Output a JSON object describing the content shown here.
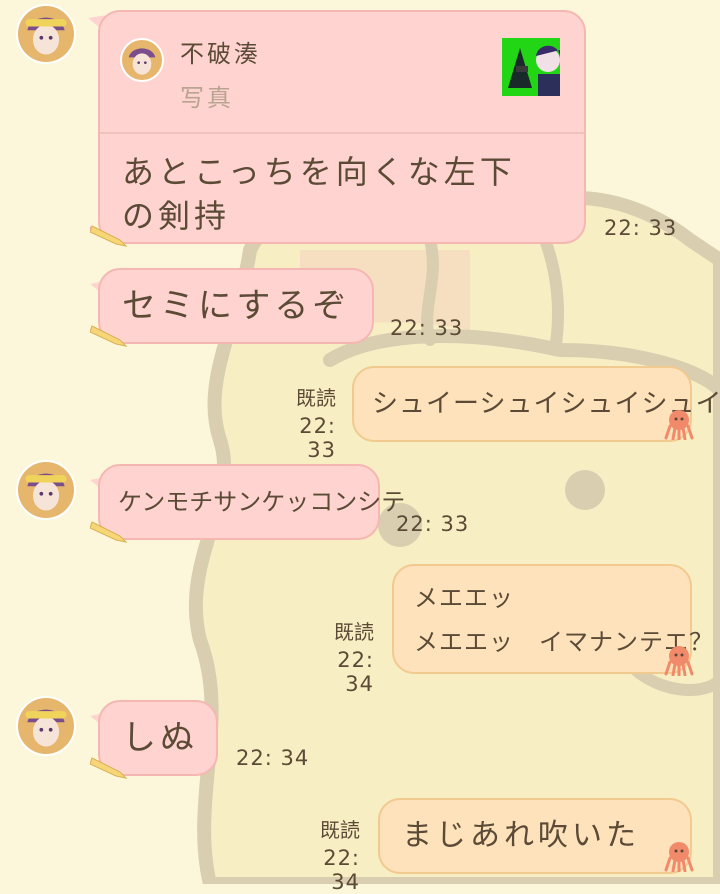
{
  "chat": {
    "messages": [
      {
        "side": "in",
        "reply": {
          "sender": "不破湊",
          "type": "写真"
        },
        "text": "あとこっちを向くな左下\nの剣持",
        "time": "22: 33"
      },
      {
        "side": "in",
        "text": "セミにするぞ",
        "time": "22: 33"
      },
      {
        "side": "out",
        "text": "シュイーシュイシュイシュイ…",
        "read": "既読",
        "time": "22: 33"
      },
      {
        "side": "in",
        "text": "ケンモチサンケッコンシテ",
        "time": "22: 33"
      },
      {
        "side": "out",
        "text": "メエエッ\nメエエッ　イマナンテエ？",
        "read": "既読",
        "time": "22: 34"
      },
      {
        "side": "in",
        "text": "しぬ",
        "time": "22: 34"
      },
      {
        "side": "out",
        "text": "まじあれ吹いた",
        "read": "既読",
        "time": "22: 34"
      }
    ]
  },
  "colors": {
    "background": "#fcf7da",
    "incoming_bubble": "#ffd3cf",
    "outgoing_bubble": "#fde2bb",
    "text": "#5b4a36"
  },
  "icons": {
    "avatar": "avatar-icon",
    "sticker": "pencil-sticker-icon",
    "outgoing_sticker": "octopus-icon"
  }
}
